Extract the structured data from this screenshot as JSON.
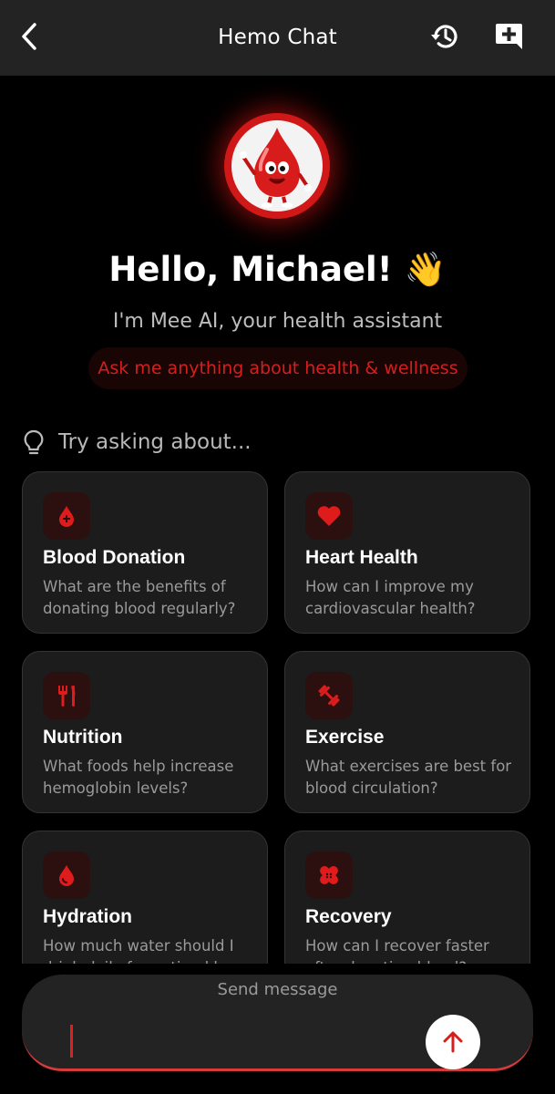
{
  "header": {
    "title": "Hemo Chat",
    "back_icon": "chevron-left-icon",
    "history_icon": "history-icon",
    "new_chat_icon": "add-comment-icon"
  },
  "hero": {
    "greeting": "Hello, Michael! 👋",
    "subtitle": "I'm Mee AI, your health assistant",
    "tagline": "Ask me anything about health & wellness"
  },
  "suggestions": {
    "label": "Try asking about...",
    "icon": "lightbulb-icon",
    "cards": [
      {
        "title": "Blood Donation",
        "desc": "What are the benefits of donating blood regularly?",
        "icon": "blood-drop-plus-icon"
      },
      {
        "title": "Heart Health",
        "desc": "How can I improve my cardiovascular health?",
        "icon": "heart-icon"
      },
      {
        "title": "Nutrition",
        "desc": "What foods help increase hemoglobin levels?",
        "icon": "utensils-icon"
      },
      {
        "title": "Exercise",
        "desc": "What exercises are best for blood circulation?",
        "icon": "dumbbell-icon"
      },
      {
        "title": "Hydration",
        "desc": "How much water should I drink daily for optimal hea",
        "icon": "water-drop-icon"
      },
      {
        "title": "Recovery",
        "desc": "How can I recover faster after donating blood?",
        "icon": "bandage-icon"
      }
    ]
  },
  "input": {
    "placeholder": "Send message",
    "value": "",
    "send_icon": "arrow-up-icon"
  },
  "colors": {
    "accent": "#d41f1f",
    "background": "#000000",
    "card": "#1c1c1c",
    "header": "#232323"
  }
}
